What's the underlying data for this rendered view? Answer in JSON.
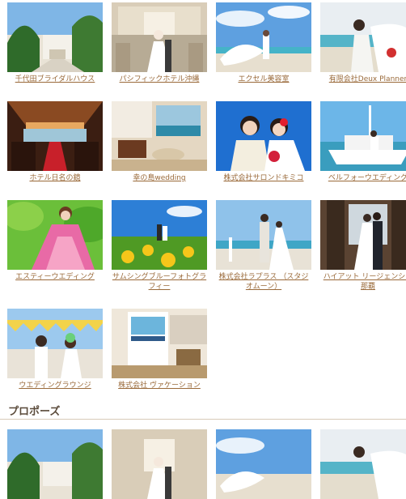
{
  "venues": [
    {
      "name": "千代田ブライダルハウス",
      "icon": "beach-chapel-photo"
    },
    {
      "name": "パシフィックホテル沖縄",
      "icon": "chapel-bride-photo"
    },
    {
      "name": "エクセル美容室",
      "icon": "beach-veil-photo"
    },
    {
      "name": "有限会社Deux Planner",
      "icon": "beach-couple-photo"
    },
    {
      "name": "ホテル日名の鏡",
      "icon": "banquet-hall-photo"
    },
    {
      "name": "幸の島wedding",
      "icon": "lounge-interior-photo"
    },
    {
      "name": "株式会社サロンドキミコ",
      "icon": "couple-portrait-photo"
    },
    {
      "name": "ベルフォーウエディング",
      "icon": "yacht-wedding-photo"
    },
    {
      "name": "エスティーウエディング",
      "icon": "flower-field-bride-photo"
    },
    {
      "name": "サムシングブルーフォトグラフィー",
      "icon": "sunflower-couple-photo"
    },
    {
      "name": "株式会社ラプラス （スタジオムーン）",
      "icon": "seaside-couple-photo"
    },
    {
      "name": "ハイアット リージェンシー那覇",
      "icon": "hotel-lobby-couple-photo"
    },
    {
      "name": "ウエディングラウンジ",
      "icon": "bunting-couple-photo"
    },
    {
      "name": "株式会社 ヴァケーション",
      "icon": "office-poster-photo"
    }
  ],
  "section": {
    "title": "プロポーズ"
  },
  "proposal": [
    {
      "icon": "beach-chapel-photo"
    },
    {
      "icon": "chapel-bride-photo"
    },
    {
      "icon": "beach-veil-photo"
    },
    {
      "icon": "beach-couple-photo"
    }
  ]
}
